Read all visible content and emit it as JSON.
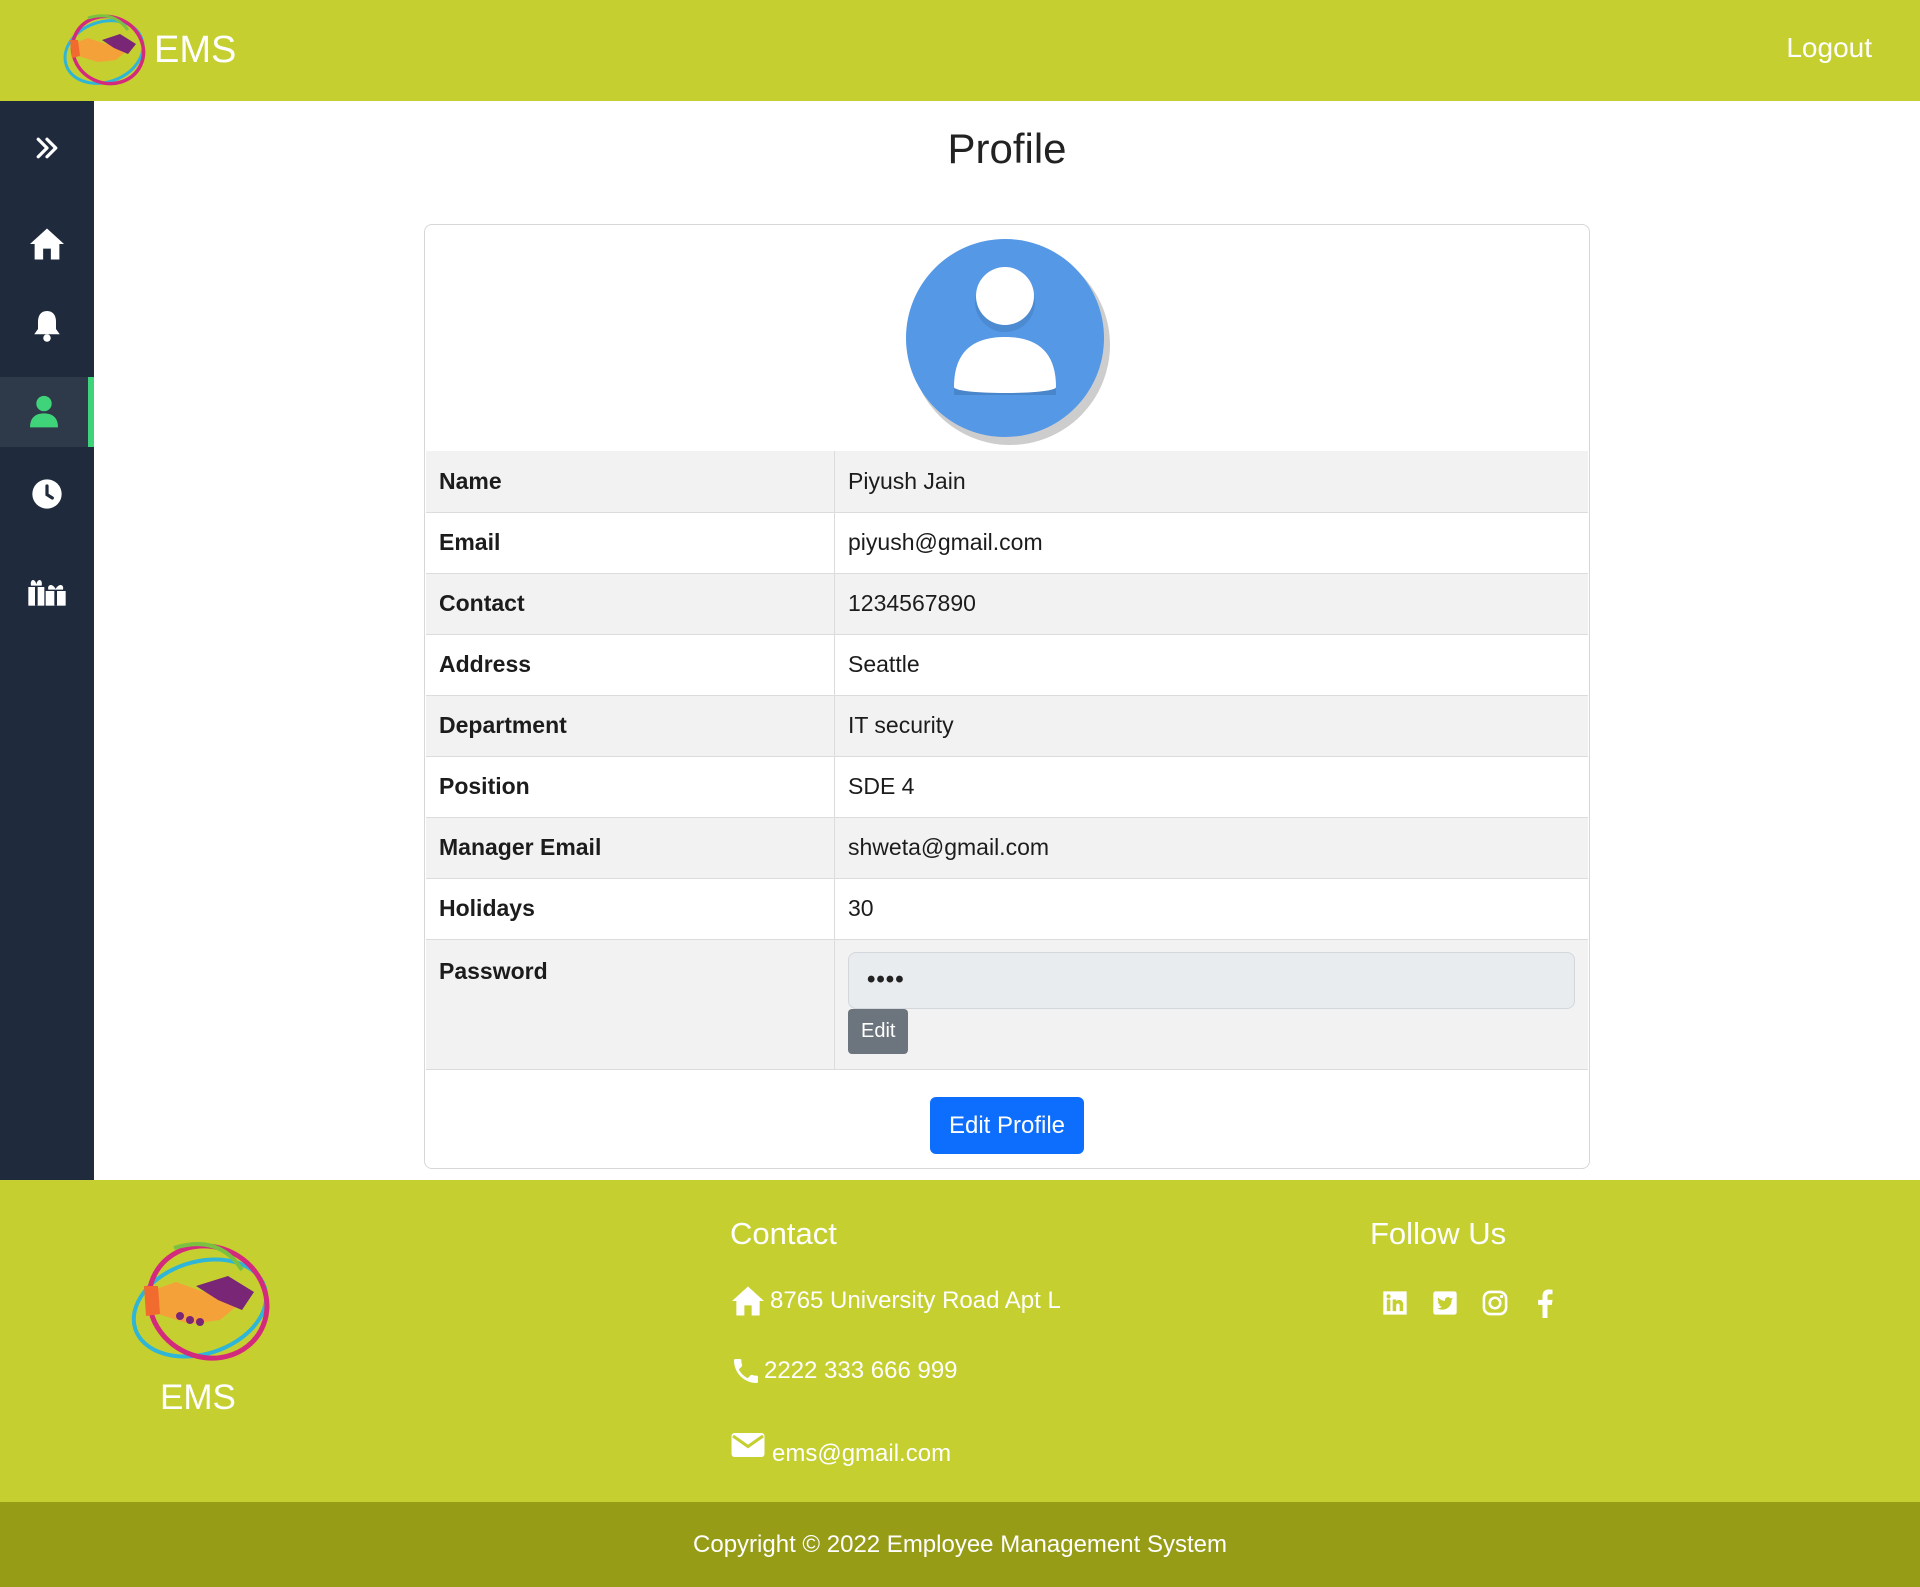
{
  "navbar": {
    "brand": "EMS",
    "logout": "Logout"
  },
  "sidebar": {
    "items": [
      {
        "icon": "chevrons-right-icon"
      },
      {
        "icon": "home-icon"
      },
      {
        "icon": "bell-icon"
      },
      {
        "icon": "user-icon",
        "active": true
      },
      {
        "icon": "clock-icon"
      },
      {
        "icon": "gifts-icon"
      }
    ],
    "active_color": "#40d47a"
  },
  "main": {
    "title": "Profile",
    "profile": {
      "rows": [
        {
          "label": "Name",
          "value": "Piyush Jain"
        },
        {
          "label": "Email",
          "value": "piyush@gmail.com"
        },
        {
          "label": "Contact",
          "value": "1234567890"
        },
        {
          "label": "Address",
          "value": "Seattle"
        },
        {
          "label": "Department",
          "value": "IT security"
        },
        {
          "label": "Position",
          "value": "SDE 4"
        },
        {
          "label": "Manager Email",
          "value": "shweta@gmail.com"
        },
        {
          "label": "Holidays",
          "value": "30"
        }
      ],
      "password": {
        "label": "Password",
        "value": "••••",
        "edit_label": "Edit"
      }
    },
    "edit_profile_label": "Edit Profile"
  },
  "footer": {
    "brand": "EMS",
    "contact": {
      "title": "Contact",
      "address": "8765 University Road Apt L",
      "phone": "2222 333 666 999",
      "email": "ems@gmail.com"
    },
    "follow": {
      "title": "Follow Us",
      "icons": [
        "linkedin-icon",
        "twitter-icon",
        "instagram-icon",
        "facebook-icon"
      ]
    },
    "copyright": "Copyright © 2022 Employee Management System"
  },
  "colors": {
    "brand_bar": "#c5cf30",
    "copyright_bar": "#979c16",
    "sidebar": "#1f2a3c",
    "primary_button": "#0d6efd",
    "avatar": "#5598e6"
  }
}
